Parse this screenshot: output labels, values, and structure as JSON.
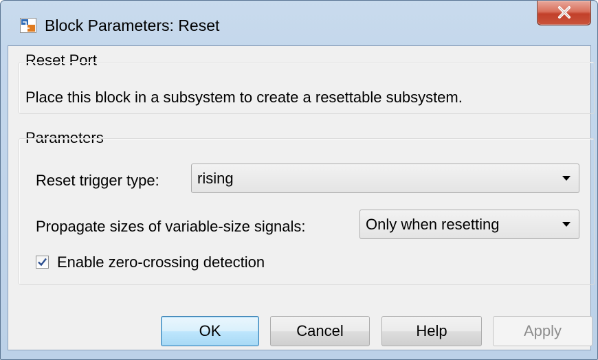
{
  "window": {
    "title": "Block Parameters: Reset",
    "close_icon": "close-icon"
  },
  "reset_port": {
    "group_label": "Reset Port",
    "description": "Place this block in a subsystem to create a resettable subsystem."
  },
  "parameters": {
    "group_label": "Parameters",
    "reset_trigger_type_label": "Reset trigger type:",
    "reset_trigger_type_value": "rising",
    "propagate_sizes_label": "Propagate sizes of variable-size signals:",
    "propagate_sizes_value": "Only when resetting",
    "zero_crossing_label": "Enable zero-crossing detection",
    "zero_crossing_checked": true
  },
  "buttons": {
    "ok": "OK",
    "cancel": "Cancel",
    "help": "Help",
    "apply": "Apply"
  },
  "colors": {
    "close_button": "#c9533b",
    "default_button_border": "#3c7fb1",
    "checkmark": "#2a4d8f"
  }
}
